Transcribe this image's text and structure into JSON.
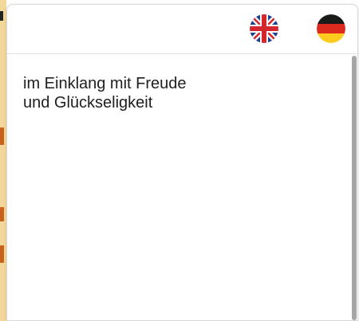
{
  "popup": {
    "languages": [
      {
        "name": "English",
        "icon": "uk-flag-icon"
      },
      {
        "name": "Deutsch",
        "icon": "germany-flag-icon"
      }
    ],
    "content": {
      "text": "im Einklang mit Freude\nund Glückseligkeit"
    }
  },
  "colors": {
    "background_accent": "#f4d79a",
    "background_mark": "#c8621b",
    "scrollbar_thumb": "#a6a6a6"
  }
}
